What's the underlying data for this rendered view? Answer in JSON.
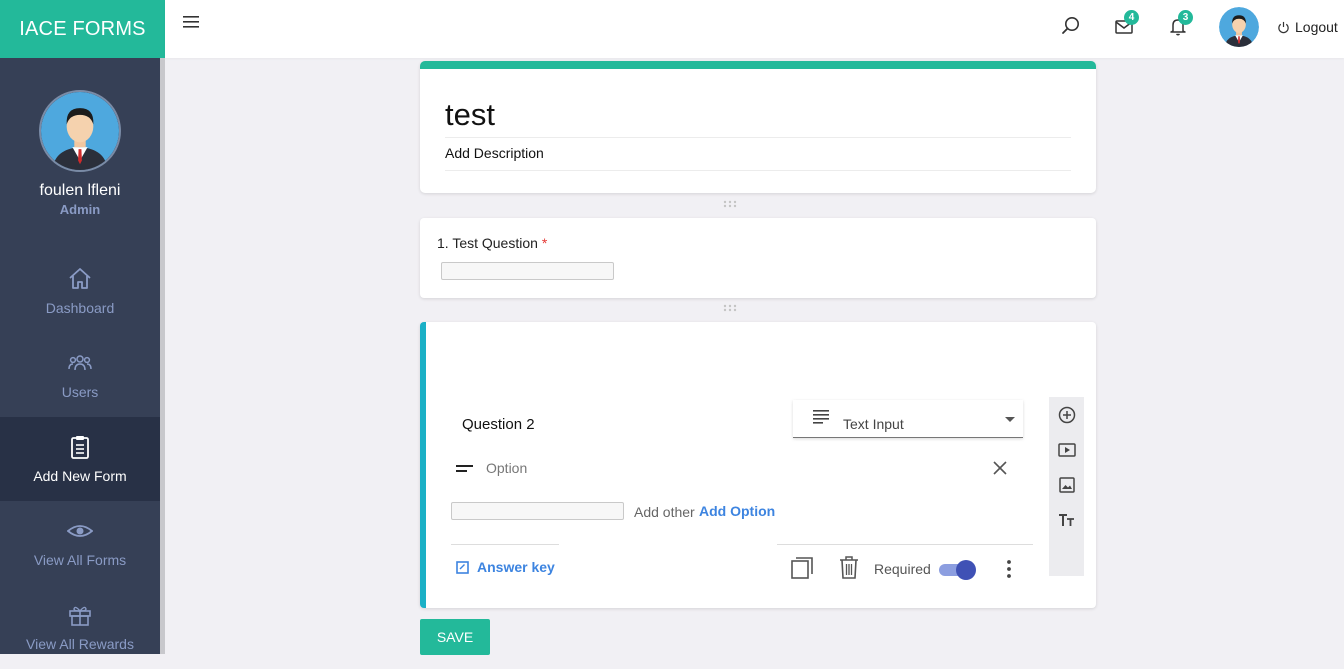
{
  "app": {
    "brand": "IACE FORMS"
  },
  "topbar": {
    "icons": [
      "menu-icon",
      "search-icon",
      "mail-icon",
      "bell-icon"
    ],
    "mail_count": "4",
    "notification_count": "3",
    "logout_label": "Logout"
  },
  "sidebar": {
    "user_name": "foulen lfleni",
    "user_role": "Admin",
    "items": [
      {
        "label": "Dashboard",
        "icon": "home-icon",
        "active": false
      },
      {
        "label": "Users",
        "icon": "users-icon",
        "active": false
      },
      {
        "label": "Add New Form",
        "icon": "clipboard-icon",
        "active": true
      },
      {
        "label": "View All Forms",
        "icon": "eye-icon",
        "active": false
      },
      {
        "label": "View All Rewards",
        "icon": "gift-icon",
        "active": false
      }
    ]
  },
  "form": {
    "title": "test",
    "description": "Add Description",
    "questions": [
      {
        "label": "1. Test Question",
        "required_mark": "*"
      },
      {
        "title": "Question 2",
        "type": "Text Input",
        "option_label": "Option",
        "add_other": "Add other",
        "add_option": "Add Option",
        "answer_key": "Answer key",
        "required_label": "Required",
        "required": true
      }
    ],
    "save_label": "SAVE"
  },
  "colors": {
    "brand": "#23b99a",
    "sidebar": "#364056",
    "sidebar_active": "#283146",
    "accent_blue": "#3d84e0",
    "question_border": "#1ab0c6",
    "toggle": "#3f51b5"
  }
}
